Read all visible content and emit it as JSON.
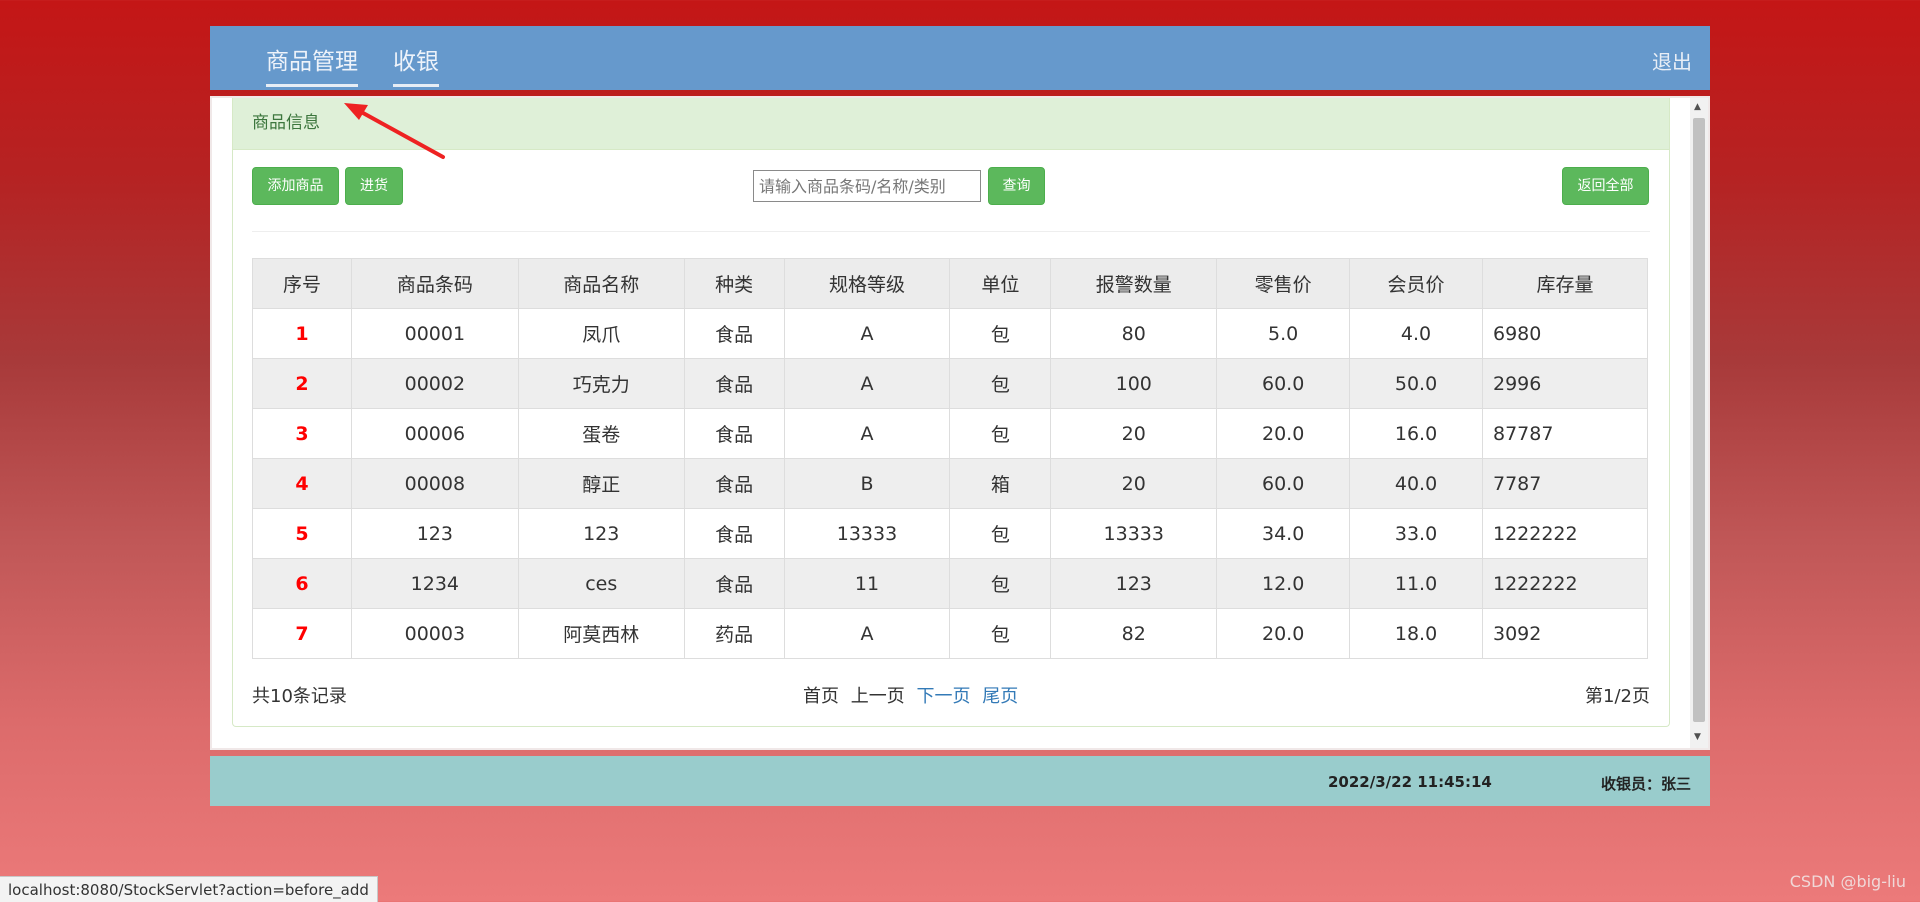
{
  "nav": {
    "tabs": [
      {
        "label": "商品管理"
      },
      {
        "label": "收银"
      }
    ],
    "logout": "退出"
  },
  "panel": {
    "title": "商品信息"
  },
  "toolbar": {
    "add_label": "添加商品",
    "stock_in_label": "进货",
    "search_placeholder": "请输入商品条码/名称/类别",
    "search_value": "",
    "query_label": "查询",
    "reset_label": "返回全部"
  },
  "table": {
    "headers": [
      "序号",
      "商品条码",
      "商品名称",
      "种类",
      "规格等级",
      "单位",
      "报警数量",
      "零售价",
      "会员价",
      "库存量"
    ],
    "rows": [
      [
        "1",
        "00001",
        "凤爪",
        "食品",
        "A",
        "包",
        "80",
        "5.0",
        "4.0",
        "6980"
      ],
      [
        "2",
        "00002",
        "巧克力",
        "食品",
        "A",
        "包",
        "100",
        "60.0",
        "50.0",
        "2996"
      ],
      [
        "3",
        "00006",
        "蛋卷",
        "食品",
        "A",
        "包",
        "20",
        "20.0",
        "16.0",
        "87787"
      ],
      [
        "4",
        "00008",
        "醇正",
        "食品",
        "B",
        "箱",
        "20",
        "60.0",
        "40.0",
        "7787"
      ],
      [
        "5",
        "123",
        "123",
        "食品",
        "13333",
        "包",
        "13333",
        "34.0",
        "33.0",
        "1222222"
      ],
      [
        "6",
        "1234",
        "ces",
        "食品",
        "11",
        "包",
        "123",
        "12.0",
        "11.0",
        "1222222"
      ],
      [
        "7",
        "00003",
        "阿莫西林",
        "药品",
        "A",
        "包",
        "82",
        "20.0",
        "18.0",
        "3092"
      ]
    ]
  },
  "footer": {
    "total": "共10条记录",
    "first": "首页",
    "prev": "上一页",
    "next": "下一页",
    "last": "尾页",
    "page_info": "第1/2页"
  },
  "status": {
    "datetime": "2022/3/22 11:45:14",
    "cashier": "收银员：张三"
  },
  "browser": {
    "status_url": "localhost:8080/StockServlet?action=before_add"
  },
  "watermark": "CSDN @big-liu",
  "colors": {
    "nav_bg": "#6699cc",
    "panel_heading_bg": "#dff0d8",
    "button_green": "#5cb85c",
    "status_bg": "#99cccc",
    "index_red": "#ff0000",
    "annotation_arrow": "#ee2222"
  }
}
